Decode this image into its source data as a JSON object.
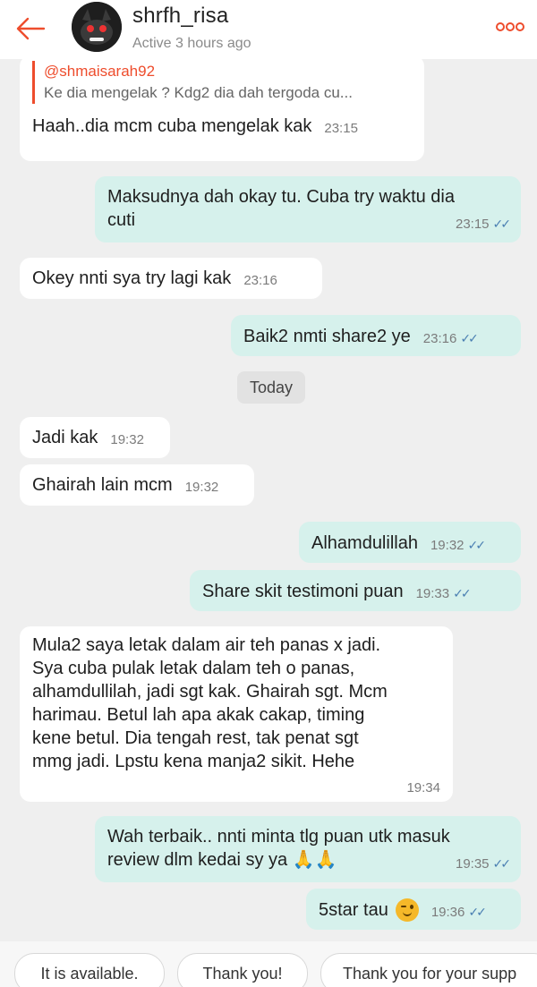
{
  "header": {
    "username": "shrfh_risa",
    "status": "Active 3 hours ago",
    "accent_color": "#ee4d2d",
    "back_icon": "arrow-left-icon",
    "more_icon": "more-options-icon"
  },
  "messages": [
    {
      "direction": "in",
      "quote_author": "@shmaisarah92",
      "quote_text": "Ke dia mengelak ? Kdg2 dia dah tergoda cu...",
      "text": "Haah..dia mcm cuba mengelak kak",
      "time": "23:15"
    },
    {
      "direction": "out",
      "text_line1": "Maksudnya dah okay tu. Cuba try waktu dia",
      "text_line2": "cuti",
      "time": "23:15",
      "status": "read"
    },
    {
      "direction": "in",
      "text": "Okey nnti sya try lagi kak",
      "time": "23:16"
    },
    {
      "direction": "out",
      "text": "Baik2 nmti share2 ye",
      "time": "23:16",
      "status": "read"
    },
    {
      "direction": "in",
      "text": "Jadi kak",
      "time": "19:32"
    },
    {
      "direction": "in",
      "text": "Ghairah lain mcm",
      "time": "19:32"
    },
    {
      "direction": "out",
      "text": "Alhamdulillah",
      "time": "19:32",
      "status": "read"
    },
    {
      "direction": "out",
      "text": "Share skit testimoni puan",
      "time": "19:33",
      "status": "read"
    },
    {
      "direction": "in",
      "lines": [
        "Mula2 saya letak dalam air teh panas x jadi.",
        "Sya cuba pulak letak dalam teh o panas,",
        "alhamdullilah, jadi sgt kak. Ghairah sgt. Mcm",
        "harimau. Betul lah apa akak cakap, timing",
        "kene betul. Dia tengah rest, tak penat sgt",
        "mmg jadi. Lpstu kena manja2 sikit. Hehe"
      ],
      "time": "19:34"
    },
    {
      "direction": "out",
      "text_line1": "Wah terbaik.. nnti minta tlg puan utk masuk",
      "text_line2": "review dlm kedai sy ya",
      "emoji": "🙏🙏",
      "time": "19:35",
      "status": "read"
    },
    {
      "direction": "out",
      "text": "5star tau",
      "emoji_icon": "winking-face-icon",
      "time": "19:36",
      "status": "read"
    }
  ],
  "date_separator": "Today",
  "quick_replies": [
    "It is available.",
    "Thank you!",
    "Thank you for your supp"
  ],
  "read_ticks": "✓✓"
}
